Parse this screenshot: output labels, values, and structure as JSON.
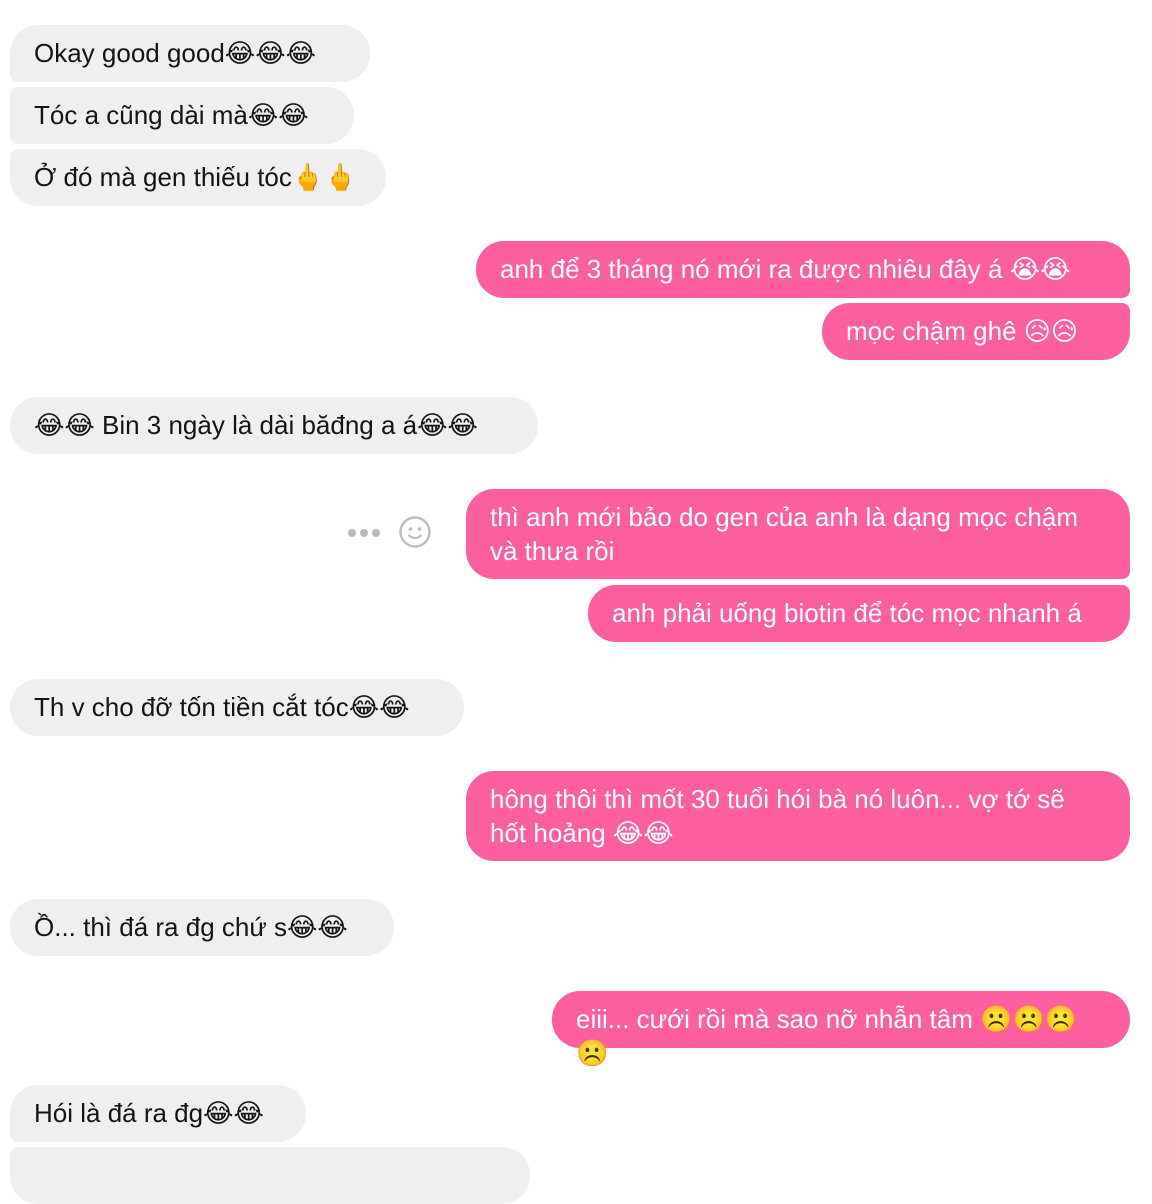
{
  "conversation": {
    "messages": [
      {
        "side": "in",
        "text": "Okay good good😂😂😂"
      },
      {
        "side": "in",
        "text": "Tóc a cũng dài mà😂😂"
      },
      {
        "side": "in",
        "text": "Ở đó mà gen thiếu tóc🖕🖕"
      },
      {
        "side": "out",
        "text": "anh để 3 tháng nó mới ra được nhiêu đây á 😭😭"
      },
      {
        "side": "out",
        "text": "mọc chậm ghê 😥😥"
      },
      {
        "side": "in",
        "text": "😂😂 Bin 3 ngày là dài băđng a á😂😂"
      },
      {
        "side": "out",
        "text": "thì anh mới bảo do gen của anh là dạng mọc chậm và thưa rồi"
      },
      {
        "side": "out",
        "text": "anh phải uống biotin để tóc mọc nhanh á"
      },
      {
        "side": "in",
        "text": "Th v cho đỡ tốn tiền cắt tóc😂😂"
      },
      {
        "side": "out",
        "text": "hông thôi thì mốt 30 tuổi hói bà nó luôn... vợ tớ sẽ hốt hoảng 😂😂"
      },
      {
        "side": "in",
        "text": "Ồ... thì đá ra đg chứ s😂😂"
      },
      {
        "side": "out",
        "text": "eiii... cưới rồi mà sao nỡ nhẫn tâm ☹️☹️☹️☹️"
      },
      {
        "side": "in",
        "text": "Hói là đá ra đg😂😂"
      }
    ]
  },
  "message_actions": {
    "more_icon": "more-dots-icon",
    "react_icon": "smiley-face-icon"
  },
  "colors": {
    "incoming_bubble": "#efefef",
    "outgoing_bubble": "#fe5fa1",
    "incoming_text": "#141414",
    "outgoing_text": "#ffffff"
  }
}
